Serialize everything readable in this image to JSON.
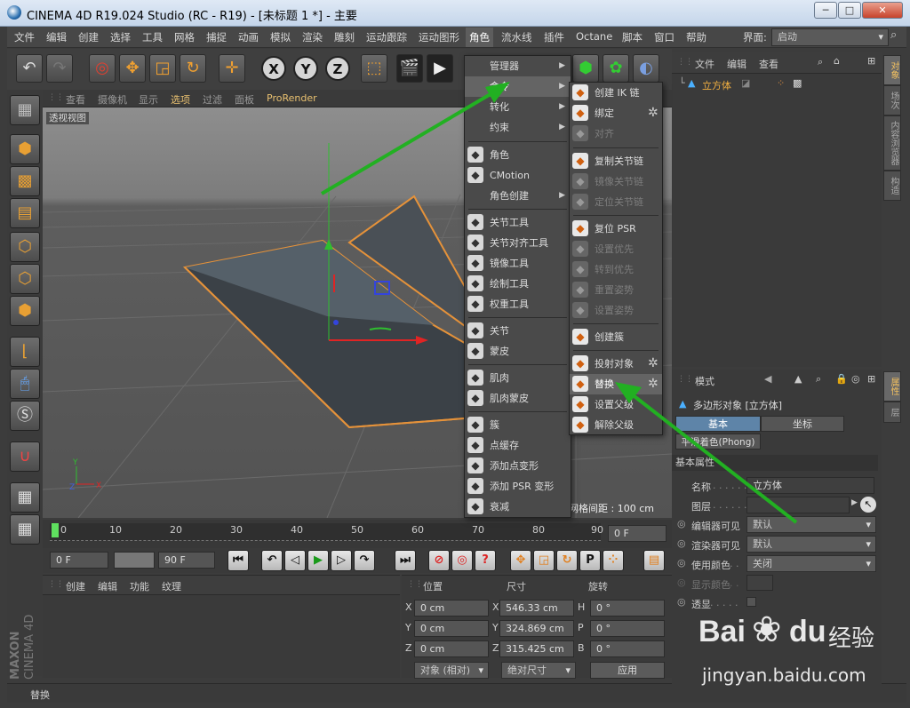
{
  "window": {
    "title": "CINEMA 4D R19.024 Studio (RC - R19) - [未标题 1 *] - 主要",
    "min": "─",
    "max": "□",
    "close": "✕"
  },
  "menubar": {
    "items": [
      "文件",
      "编辑",
      "创建",
      "选择",
      "工具",
      "网格",
      "捕捉",
      "动画",
      "模拟",
      "渲染",
      "雕刻",
      "运动跟踪",
      "运动图形",
      "角色",
      "流水线",
      "插件",
      "Octane",
      "脚本",
      "窗口",
      "帮助"
    ],
    "layout_label": "界面:",
    "layout_value": "启动"
  },
  "toolbar": {
    "undo": "↶",
    "redo": "↷",
    "x_axis": "X",
    "y_axis": "Y",
    "z_axis": "Z"
  },
  "viewport_menu": {
    "items": [
      "查看",
      "摄像机",
      "显示",
      "选项",
      "过滤",
      "面板",
      "ProRender"
    ],
    "selected": "选项"
  },
  "viewport": {
    "label": "透视视图",
    "grid_info": "网格间距 : 100 cm",
    "axis_x": "X",
    "axis_y": "Y",
    "axis_z": "Z"
  },
  "timeline": {
    "ticks": [
      "0",
      "10",
      "20",
      "30",
      "40",
      "50",
      "60",
      "70",
      "80",
      "90"
    ],
    "current_frame": "0 F"
  },
  "transport": {
    "start": "0 F",
    "preview_min": "0 F",
    "end": "90 F"
  },
  "material_menu": [
    "创建",
    "编辑",
    "功能",
    "纹理"
  ],
  "coords": {
    "headers": {
      "position": "位置",
      "size": "尺寸",
      "rotation": "旋转"
    },
    "rows": [
      {
        "axis": "X",
        "pos": "0 cm",
        "size_axis": "X",
        "size": "546.33 cm",
        "rot_axis": "H",
        "rot": "0 °"
      },
      {
        "axis": "Y",
        "pos": "0 cm",
        "size_axis": "Y",
        "size": "324.869 cm",
        "rot_axis": "P",
        "rot": "0 °"
      },
      {
        "axis": "Z",
        "pos": "0 cm",
        "size_axis": "Z",
        "size": "315.425 cm",
        "rot_axis": "B",
        "rot": "0 °"
      }
    ],
    "mode": "对象 (相对)",
    "size_mode": "绝对尺寸",
    "apply": "应用"
  },
  "status": "替换",
  "objects_panel": {
    "menu": [
      "文件",
      "编辑",
      "查看"
    ],
    "object_name": "立方体"
  },
  "right_tabs": {
    "objects": "对象",
    "takes": "场次",
    "content_browser": "内容浏览器",
    "structure": "构造",
    "attributes": "属性",
    "layers": "层"
  },
  "attributes": {
    "mode": "模式",
    "object_title": "多边形对象 [立方体]",
    "tabs": [
      "基本",
      "坐标"
    ],
    "phong": "平滑着色(Phong)",
    "section": "基本属性",
    "rows": [
      {
        "label": "名称",
        "dots": " . . . . . . ",
        "value": "立方体"
      },
      {
        "label": "图层",
        "dots": " . . . . . . ",
        "value": ""
      },
      {
        "label": "编辑器可见",
        "dots": "",
        "value": "默认"
      },
      {
        "label": "渲染器可见",
        "dots": "",
        "value": "默认"
      },
      {
        "label": "使用颜色",
        "dots": " . . . ",
        "value": "关闭"
      },
      {
        "label": "显示颜色",
        "dots": " . . . ",
        "value": ""
      },
      {
        "label": "透显",
        "dots": " . . . . . . ",
        "value": ""
      }
    ]
  },
  "char_menu": [
    {
      "label": "管理器",
      "sub": true
    },
    {
      "label": "命令",
      "sub": true,
      "hl": true
    },
    {
      "label": "转化",
      "sub": true
    },
    {
      "label": "约束",
      "sub": true
    },
    {
      "label": "角色",
      "icon": "figure-icon"
    },
    {
      "label": "CMotion",
      "icon": "walk-icon"
    },
    {
      "label": "角色创建",
      "sub": true
    },
    {
      "label": "关节工具",
      "icon": "joint-tool-icon"
    },
    {
      "label": "关节对齐工具",
      "icon": "joint-align-icon"
    },
    {
      "label": "镜像工具",
      "icon": "mirror-tool-icon"
    },
    {
      "label": "绘制工具",
      "icon": "paint-tool-icon"
    },
    {
      "label": "权重工具",
      "icon": "weight-tool-icon"
    },
    {
      "label": "关节",
      "icon": "joint-icon"
    },
    {
      "label": "蒙皮",
      "icon": "skin-icon"
    },
    {
      "label": "肌肉",
      "icon": "muscle-icon"
    },
    {
      "label": "肌肉蒙皮",
      "icon": "muscle-skin-icon"
    },
    {
      "label": "簇",
      "icon": "cluster-icon"
    },
    {
      "label": "点缓存",
      "icon": "point-cache-icon"
    },
    {
      "label": "添加点变形",
      "icon": "add-point-morph-icon"
    },
    {
      "label": "添加 PSR 变形",
      "icon": "add-psr-morph-icon"
    },
    {
      "label": "衰减",
      "icon": "falloff-icon"
    }
  ],
  "cmd_menu": [
    {
      "label": "创建 IK 链",
      "icon": "ik-chain-icon"
    },
    {
      "label": "绑定",
      "icon": "bind-icon",
      "gear": true
    },
    {
      "label": "对齐",
      "icon": "align-icon",
      "dis": true
    },
    {
      "label": "复制关节链",
      "icon": "copy-chain-icon"
    },
    {
      "label": "镜像关节链",
      "icon": "mirror-chain-icon",
      "dis": true
    },
    {
      "label": "定位关节链",
      "icon": "position-chain-icon",
      "dis": true
    },
    {
      "label": "复位 PSR",
      "icon": "reset-psr-icon"
    },
    {
      "label": "设置优先",
      "icon": "set-priority-icon",
      "dis": true
    },
    {
      "label": "转到优先",
      "icon": "goto-priority-icon",
      "dis": true
    },
    {
      "label": "重置姿势",
      "icon": "reset-pose-icon",
      "dis": true
    },
    {
      "label": "设置姿势",
      "icon": "set-pose-icon",
      "dis": true
    },
    {
      "label": "创建簇",
      "icon": "create-cluster-icon"
    },
    {
      "label": "投射对象",
      "icon": "project-object-icon",
      "gear": true
    },
    {
      "label": "替换",
      "icon": "replace-icon",
      "hl": true,
      "gear": true
    },
    {
      "label": "设置父级",
      "icon": "set-parent-icon"
    },
    {
      "label": "解除父级",
      "icon": "unparent-icon"
    }
  ],
  "watermark": {
    "brand": "Bai",
    "brand2": "du",
    "cn": "经验",
    "url": "jingyan.baidu.com"
  },
  "logo": {
    "line1": "MAXON",
    "line2": "CINEMA 4D"
  },
  "colors": {
    "accent": "#f0a030",
    "arrow": "#22aa22",
    "highlight": "#646464"
  }
}
